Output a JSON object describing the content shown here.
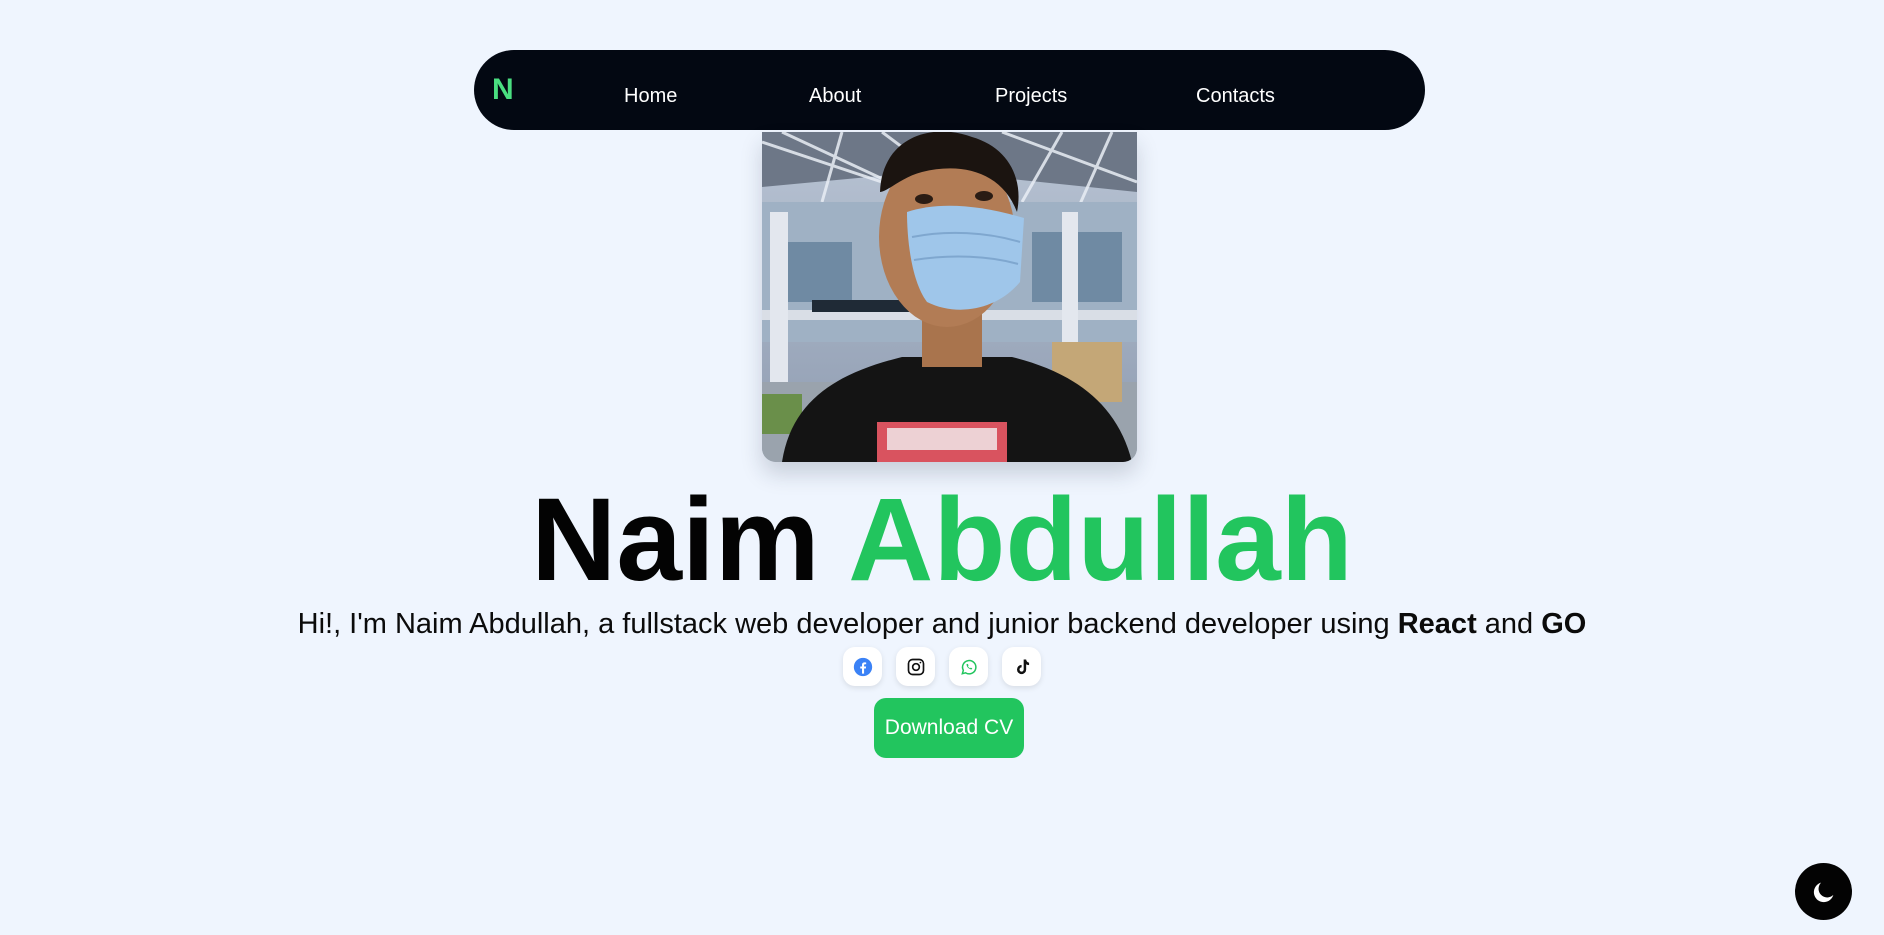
{
  "nav": {
    "logo": "N",
    "links": [
      {
        "label": "Home"
      },
      {
        "label": "About"
      },
      {
        "label": "Projects"
      },
      {
        "label": "Contacts"
      }
    ]
  },
  "hero": {
    "first_name": "Naim",
    "last_name": "Abdullah",
    "intro_prefix": "Hi!, I'm Naim Abdullah, a fullstack web developer and junior backend developer using",
    "tech_1": "React",
    "conjunction": "and",
    "tech_2": "GO",
    "cv_button": "Download CV"
  },
  "socials": [
    {
      "icon": "facebook-icon",
      "color": "#3b82f6"
    },
    {
      "icon": "instagram-icon",
      "color": "#111111"
    },
    {
      "icon": "whatsapp-icon",
      "color": "#22c55e"
    },
    {
      "icon": "tiktok-icon",
      "color": "#111111"
    }
  ],
  "theme_toggle": {
    "icon": "moon-icon"
  },
  "colors": {
    "background": "#eff5fe",
    "navbar": "#030812",
    "accent": "#22c55e",
    "logo": "#4ade80"
  }
}
